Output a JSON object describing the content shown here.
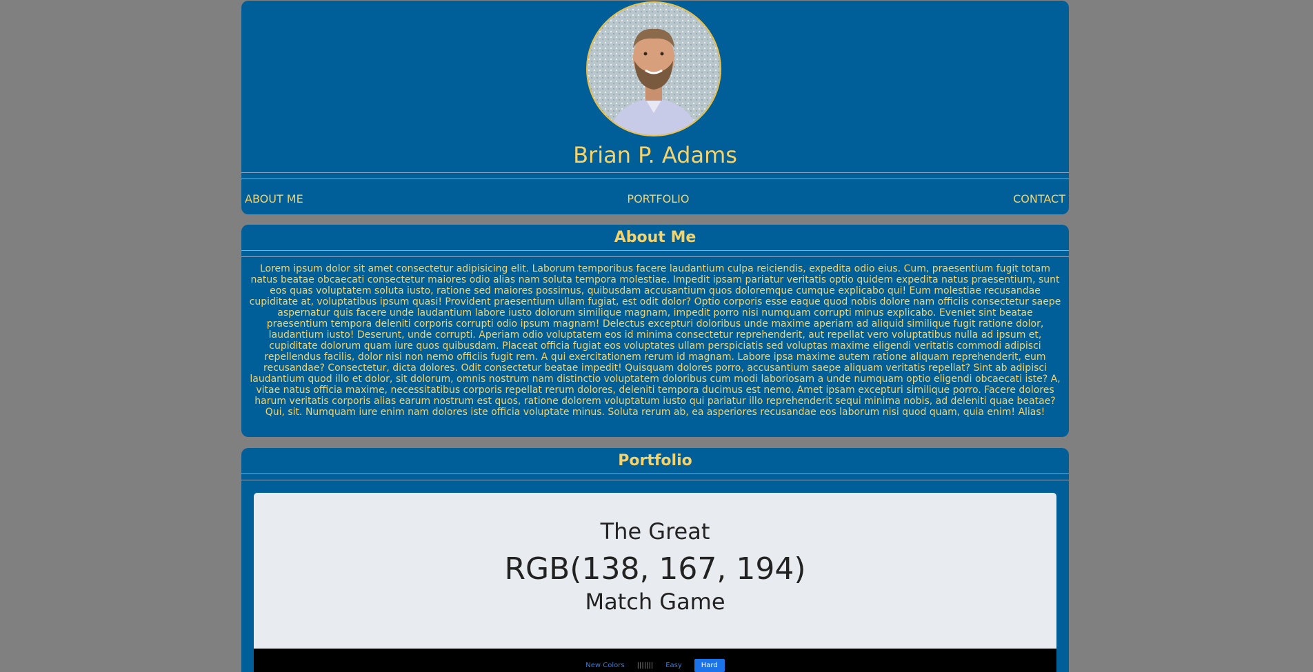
{
  "header": {
    "name": "Brian P. Adams",
    "nav": {
      "about": "ABOUT ME",
      "portfolio": "PORTFOLIO",
      "contact": "CONTACT"
    }
  },
  "about": {
    "title": "About Me",
    "text": "Lorem ipsum dolor sit amet consectetur adipisicing elit. Laborum temporibus facere laudantium culpa reiciendis, expedita odio eius. Cum, praesentium fugit totam natus beatae obcaecati consectetur maiores odio alias nam soluta tempora molestiae. Impedit ipsam pariatur veritatis optio quidem expedita natus praesentium, sunt eos quas voluptatem soluta iusto, ratione sed maiores possimus, quibusdam accusantium quos doloremque cumque explicabo qui! Eum molestiae recusandae cupiditate at, voluptatibus ipsum quasi! Provident praesentium ullam fugiat, est odit dolor? Optio corporis esse eaque quod nobis dolore nam officiis consectetur saepe aspernatur quis facere unde laudantium labore iusto dolorum similique magnam, impedit porro nisi numquam corrupti minus explicabo. Eveniet sint beatae praesentium tempora deleniti corporis corrupti odio ipsum magnam! Delectus excepturi doloribus unde maxime aperiam ad aliquid similique fugit ratione dolor, laudantium iusto! Deserunt, unde corrupti. Aperiam odio voluptatem eos id minima consectetur reprehenderit, aut repellat vero voluptatibus nulla ad ipsum et, cupiditate dolorum quam iure quos quibusdam. Placeat officia fugiat eos voluptates ullam perspiciatis sed voluptas maxime eligendi veritatis commodi adipisci repellendus facilis, dolor nisi non nemo officiis fugit rem. A qui exercitationem rerum id magnam. Labore ipsa maxime autem ratione aliquam reprehenderit, eum recusandae? Consectetur, dicta dolores. Odit consectetur beatae impedit! Quisquam dolores porro, accusantium saepe aliquam veritatis repellat? Sint ab adipisci laudantium quod illo et dolor, sit dolorum, omnis nostrum nam distinctio voluptatem doloribus cum modi laboriosam a unde numquam optio eligendi obcaecati iste? A, vitae natus officia maxime, necessitatibus corporis repellat rerum dolores, deleniti tempora ducimus est nemo. Amet ipsam excepturi similique porro. Facere dolores harum veritatis corporis alias earum nostrum est quos, ratione dolorem voluptatum iusto qui pariatur illo reprehenderit sequi minima nobis, ad deleniti quae beatae? Qui, sit. Numquam iure enim nam dolores iste officia voluptate minus. Soluta rerum ab, ea asperiores recusandae eos laborum nisi quod quam, quia enim! Alias!"
  },
  "portfolio": {
    "title": "Portfolio",
    "game": {
      "line1": "The Great",
      "line2": "RGB(138, 167, 194)",
      "line3": "Match Game",
      "controls": {
        "new_colors": "New Colors",
        "message": "|||||||",
        "easy": "Easy",
        "hard": "Hard"
      }
    }
  },
  "colors": {
    "background": "#808080",
    "panel": "#005f99",
    "accent_text": "#f6d36a",
    "card": "#e8ecf0",
    "hard_button": "#1a73e8"
  },
  "icons": {
    "avatar": "profile-photo"
  }
}
